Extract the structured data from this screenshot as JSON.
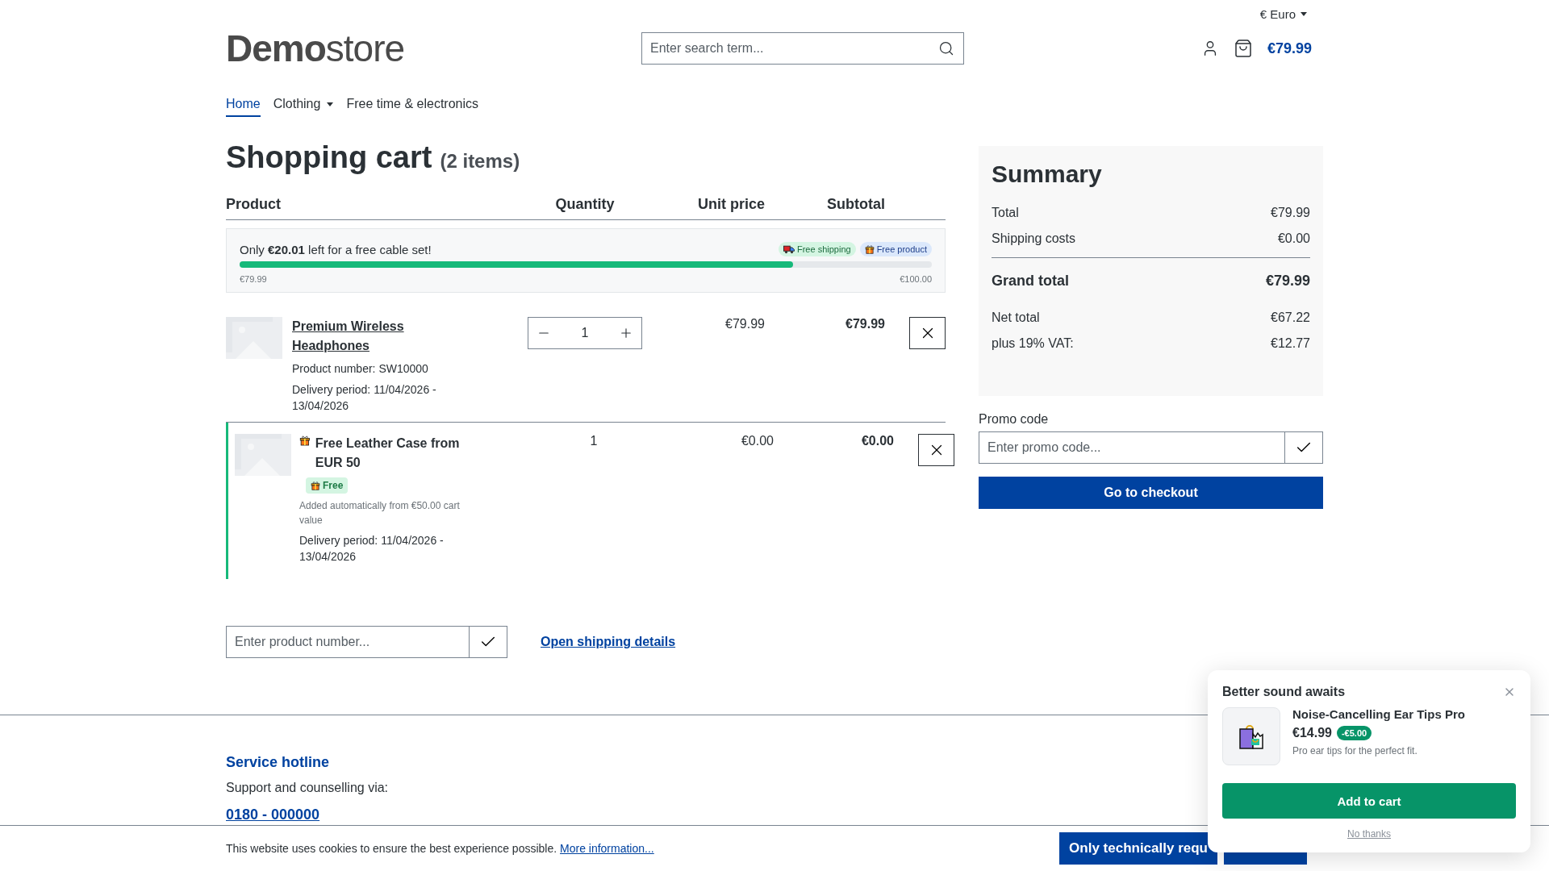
{
  "header": {
    "currency": "€ Euro",
    "logo": {
      "bold": "Demo",
      "light": "store"
    },
    "search": {
      "placeholder": "Enter search term..."
    },
    "cart_total": "€79.99"
  },
  "nav": [
    {
      "label": "Home",
      "selected": true,
      "dropdown": false
    },
    {
      "label": "Clothing",
      "selected": false,
      "dropdown": true
    },
    {
      "label": "Free time & electronics",
      "selected": false,
      "dropdown": false
    }
  ],
  "cart": {
    "title": "Shopping cart",
    "count": "(2 items)",
    "columns": [
      "Product",
      "Quantity",
      "Unit price",
      "Subtotal"
    ],
    "free_goal": {
      "message": "Only **€20.01** left for a free cable set!",
      "badges": [
        {
          "kind": "shipping",
          "label": "Free shipping"
        },
        {
          "kind": "product",
          "label": "Free product"
        }
      ],
      "level": 0.7999,
      "start": "€79.99",
      "end": "€100.00"
    },
    "items": [
      {
        "kind": "regular",
        "name": "Premium Wireless Headphones",
        "product_number": "Product number: SW10000",
        "delivery": "Delivery period: 11/04/2026 - 13/04/2026",
        "quantity": "1",
        "unit_price": "€79.99",
        "subtotal": "€79.99"
      },
      {
        "kind": "free",
        "name": "Free Leather Case from EUR 50",
        "badge": "Free",
        "note": "Added automatically from €50.00 cart value",
        "delivery": "Delivery period: 11/04/2026 - 13/04/2026",
        "quantity": "1",
        "unit_price": "€0.00",
        "subtotal": "€0.00"
      }
    ]
  },
  "add_product": {
    "placeholder": "Enter product number..."
  },
  "shipping_link": "Open shipping details",
  "summary": {
    "title": "Summary",
    "rows": [
      {
        "kind": "line",
        "label": "Total",
        "value": "€79.99"
      },
      {
        "kind": "line",
        "label": "Shipping costs",
        "value": "€0.00"
      },
      {
        "kind": "grand",
        "label": "Grand total",
        "value": "€79.99"
      },
      {
        "kind": "net",
        "label": "Net total",
        "value": "€67.22"
      },
      {
        "kind": "line",
        "label": "plus 19% VAT:",
        "value": "€12.77"
      }
    ],
    "promo_label": "Promo code",
    "promo_placeholder": "Enter promo code...",
    "checkout": "Go to checkout"
  },
  "footer": {
    "title": "Service hotline",
    "text": "Support and counselling via:",
    "phone": "0180 - 000000"
  },
  "cookie": {
    "text": "This website uses cookies to ensure the best experience possible.",
    "link": "More information...",
    "buttons": [
      {
        "kind": "labelled",
        "label": "Only technically requ"
      },
      {
        "kind": "covered"
      }
    ]
  },
  "popup": {
    "title": "Better sound awaits",
    "product": "Noise-Cancelling Ear Tips Pro",
    "price": "€14.99",
    "discount": "-€5.00",
    "description": "Pro ear tips for the perfect fit.",
    "add": "Add to cart",
    "decline": "No thanks"
  }
}
